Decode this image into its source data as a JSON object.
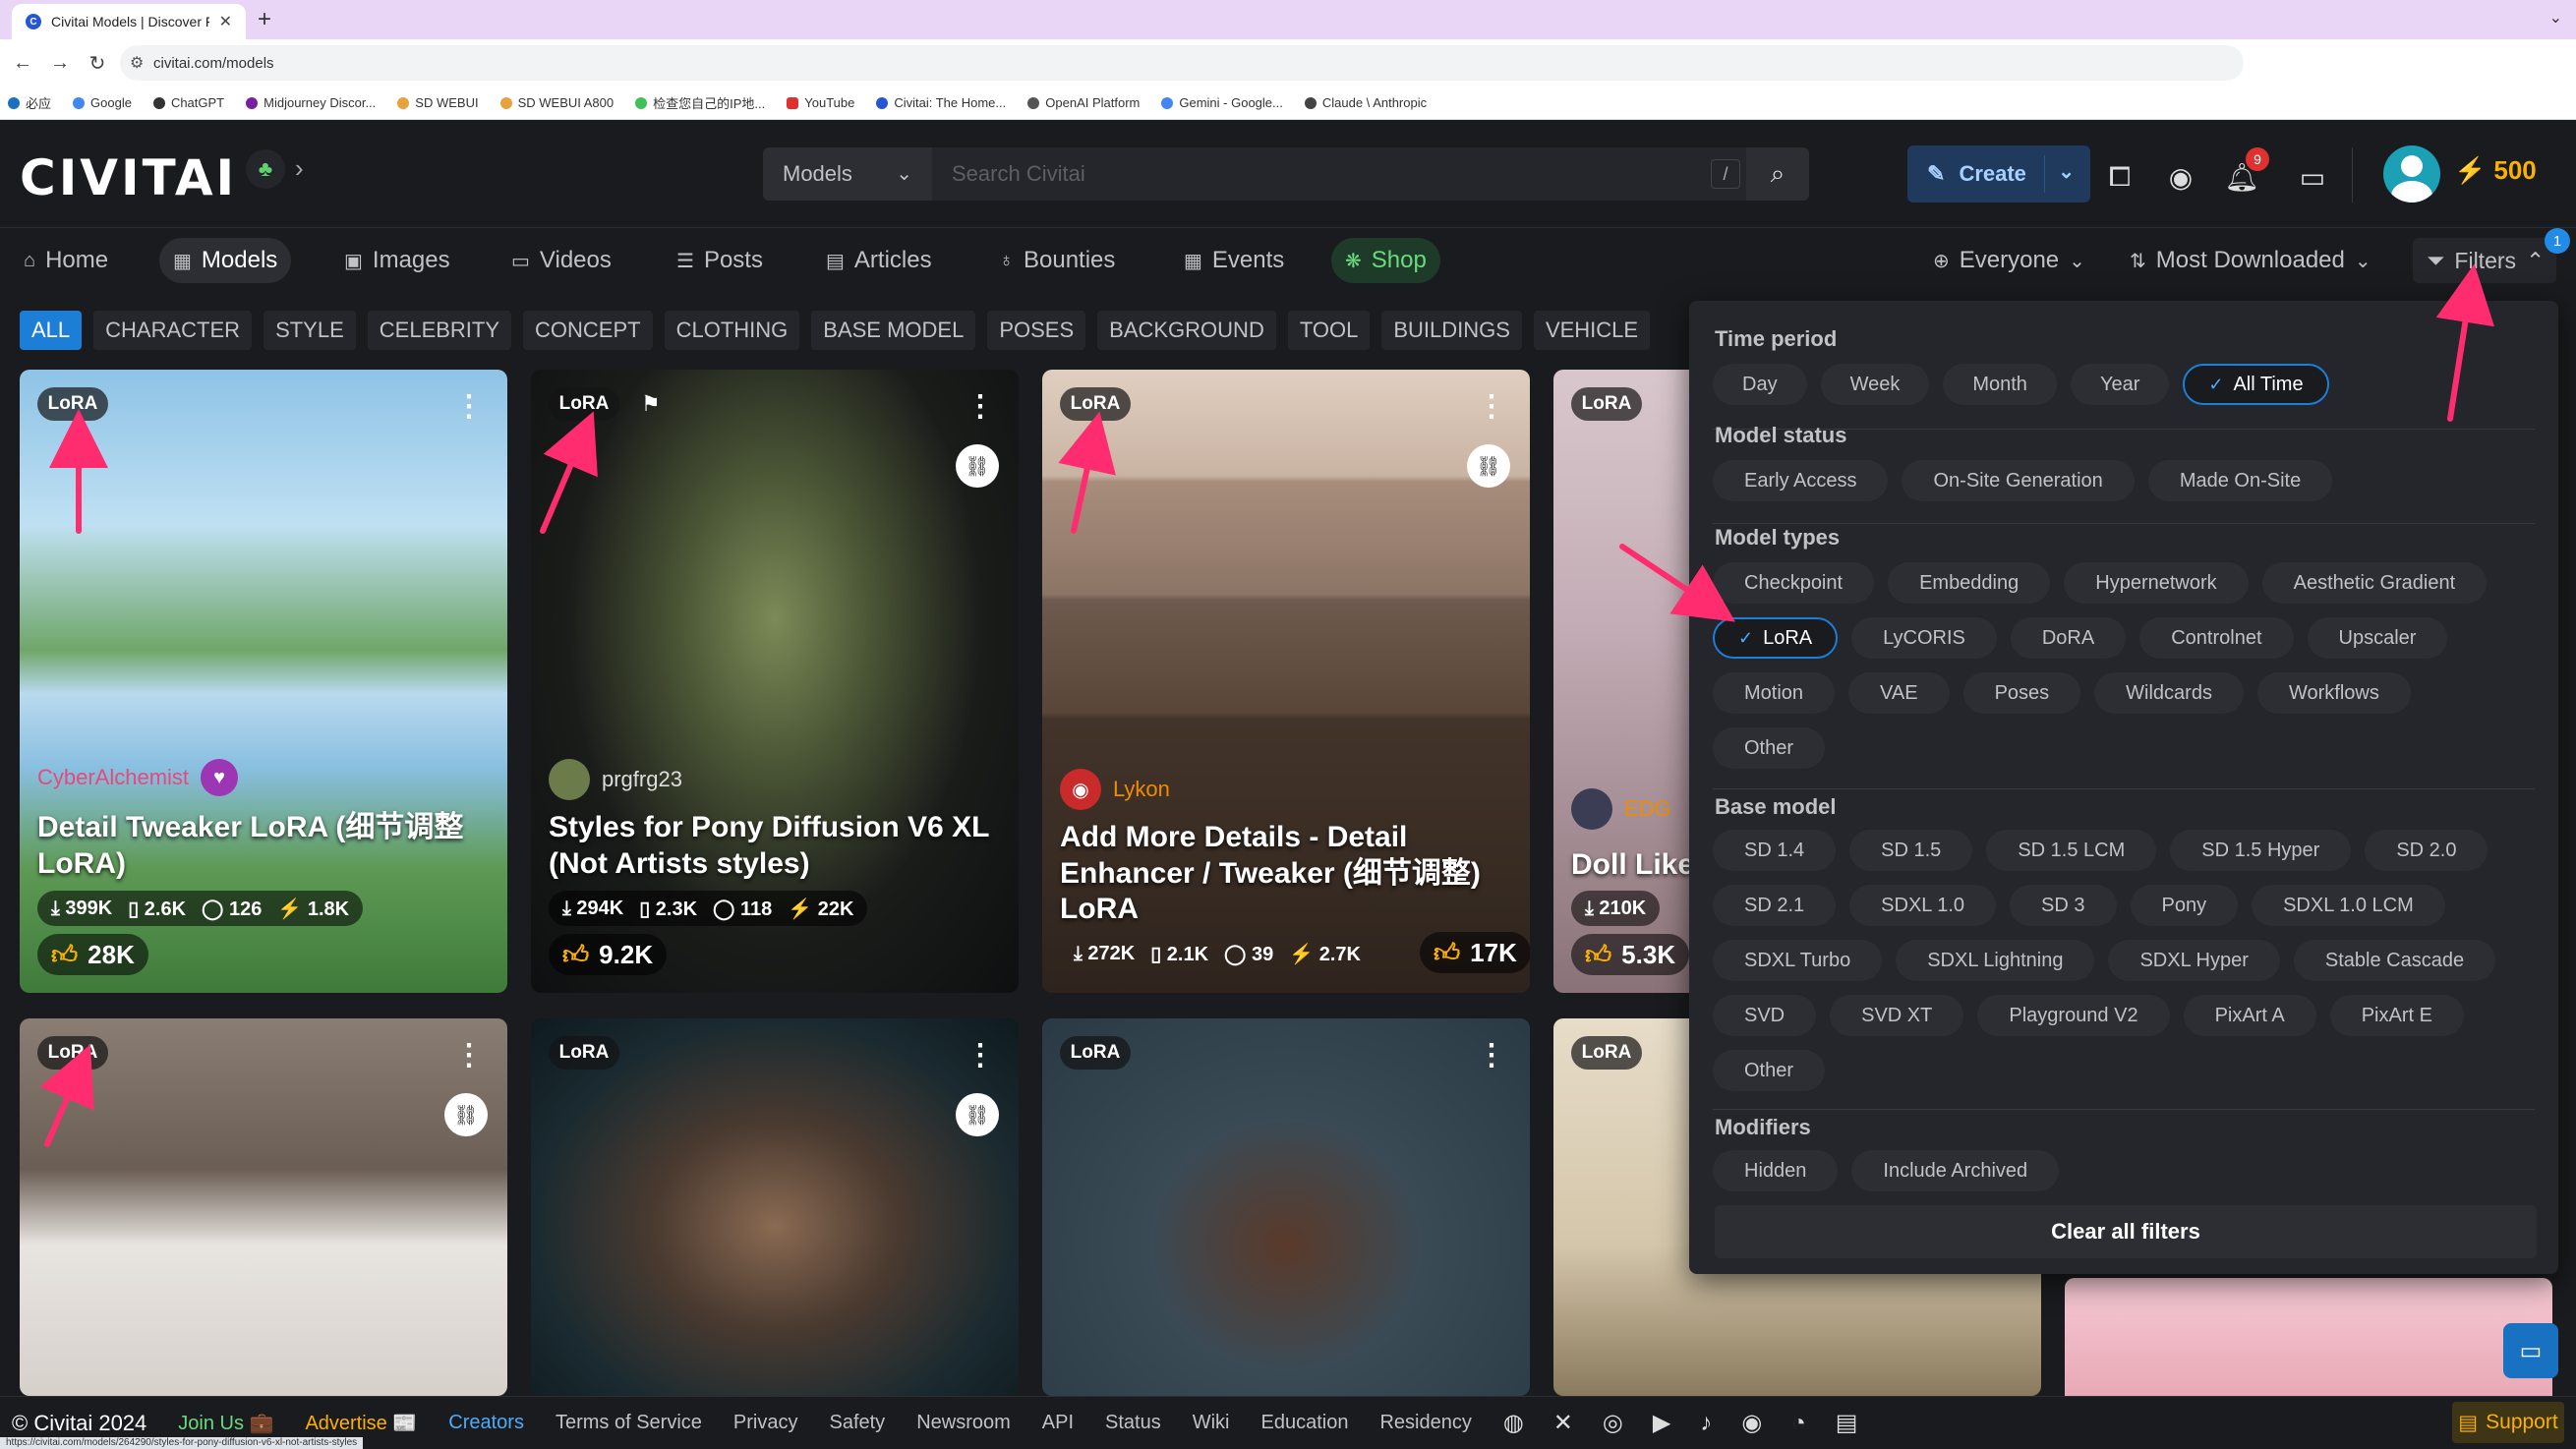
{
  "browser": {
    "tab_title": "Civitai Models | Discover Fre",
    "url": "civitai.com/models",
    "bookmarks": [
      "必应",
      "Google",
      "ChatGPT",
      "Midjourney Discor...",
      "SD WEBUI",
      "SD WEBUI A800",
      "检查您自己的IP地...",
      "YouTube",
      "Civitai: The Home...",
      "OpenAI Platform",
      "Gemini - Google...",
      "Claude \\ Anthropic"
    ],
    "status_url": "https://civitai.com/models/264290/styles-for-pony-diffusion-v6-xl-not-artists-styles"
  },
  "header": {
    "logo": "CIVITAI",
    "search_type": "Models",
    "search_placeholder": "Search Civitai",
    "search_shortcut": "/",
    "create_label": "Create",
    "notification_count": "9",
    "buzz": "500"
  },
  "nav": {
    "items": [
      "Home",
      "Models",
      "Images",
      "Videos",
      "Posts",
      "Articles",
      "Bounties",
      "Events",
      "Shop"
    ],
    "audience": "Everyone",
    "sort": "Most Downloaded",
    "filters_label": "Filters",
    "filters_count": "1"
  },
  "categories": [
    "ALL",
    "CHARACTER",
    "STYLE",
    "CELEBRITY",
    "CONCEPT",
    "CLOTHING",
    "BASE MODEL",
    "POSES",
    "BACKGROUND",
    "TOOL",
    "BUILDINGS",
    "VEHICLE"
  ],
  "cards": [
    {
      "badge": "LoRA",
      "creator": "CyberAlchemist",
      "title": "Detail Tweaker LoRA (细节调整LoRA)",
      "downloads": "399K",
      "saves": "2.6K",
      "comments": "126",
      "buzz": "1.8K",
      "likes": "28K"
    },
    {
      "badge": "LoRA",
      "creator": "prgfrg23",
      "title": "Styles for Pony Diffusion V6 XL (Not Artists styles)",
      "downloads": "294K",
      "saves": "2.3K",
      "comments": "118",
      "buzz": "22K",
      "likes": "9.2K"
    },
    {
      "badge": "LoRA",
      "creator": "Lykon",
      "title": "Add More Details - Detail Enhancer / Tweaker (细节调整) LoRA",
      "downloads": "272K",
      "saves": "2.1K",
      "comments": "39",
      "buzz": "2.7K",
      "likes": "17K"
    },
    {
      "badge": "LoRA",
      "creator": "EDG",
      "title": "Doll Like",
      "downloads": "210K",
      "likes": "5.3K"
    },
    {
      "badge": "LoRA"
    },
    {
      "badge": "LoRA"
    },
    {
      "badge": "LoRA"
    },
    {
      "badge": "LoRA"
    }
  ],
  "filters": {
    "time_period": {
      "label": "Time period",
      "options": [
        "Day",
        "Week",
        "Month",
        "Year",
        "All Time"
      ],
      "selected": "All Time"
    },
    "model_status": {
      "label": "Model status",
      "options": [
        "Early Access",
        "On-Site Generation",
        "Made On-Site"
      ]
    },
    "model_types": {
      "label": "Model types",
      "rows": [
        [
          "Checkpoint",
          "Embedding",
          "Hypernetwork",
          "Aesthetic Gradient"
        ],
        [
          "LoRA",
          "LyCORIS",
          "DoRA",
          "Controlnet",
          "Upscaler"
        ],
        [
          "Motion",
          "VAE",
          "Poses",
          "Wildcards",
          "Workflows"
        ],
        [
          "Other"
        ]
      ],
      "selected": "LoRA"
    },
    "base_model": {
      "label": "Base model",
      "rows": [
        [
          "SD 1.4",
          "SD 1.5",
          "SD 1.5 LCM",
          "SD 1.5 Hyper",
          "SD 2.0"
        ],
        [
          "SD 2.1",
          "SDXL 1.0",
          "SD 3",
          "Pony",
          "SDXL 1.0 LCM"
        ],
        [
          "SDXL Turbo",
          "SDXL Lightning",
          "SDXL Hyper",
          "Stable Cascade"
        ],
        [
          "SVD",
          "SVD XT",
          "Playground V2",
          "PixArt A",
          "PixArt E"
        ],
        [
          "Other"
        ]
      ]
    },
    "modifiers": {
      "label": "Modifiers",
      "options": [
        "Hidden",
        "Include Archived"
      ]
    },
    "clear_label": "Clear all filters"
  },
  "footer": {
    "copyright": "© Civitai 2024",
    "links": [
      "Join Us 💼",
      "Advertise 📰",
      "Creators",
      "Terms of Service",
      "Privacy",
      "Safety",
      "Newsroom",
      "API",
      "Status",
      "Wiki",
      "Education",
      "Residency"
    ],
    "support": "Support"
  },
  "colors": {
    "accent": "#1c7ed6",
    "annotation_arrow": "#ff2d6f",
    "background": "#1a1b1e",
    "panel": "#25262b"
  }
}
